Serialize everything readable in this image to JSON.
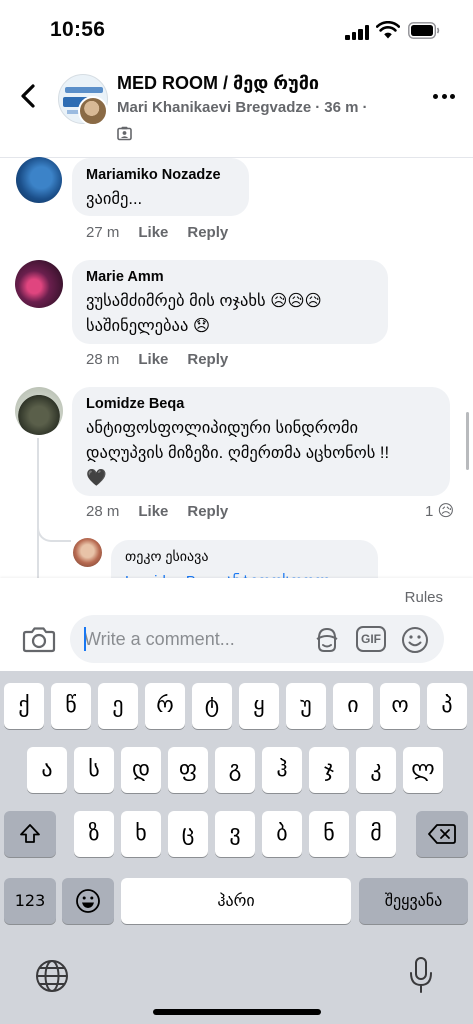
{
  "status_bar": {
    "time": "10:56"
  },
  "header": {
    "title": "MED ROOM / მედ რუმი",
    "author": "Mari Khanikaevi Bregvadze",
    "age": "36 m",
    "separator": "·"
  },
  "comments": [
    {
      "author": "Mariamiko Nozadze",
      "text": "ვაიმე...",
      "time": "27 m",
      "like_label": "Like",
      "reply_label": "Reply"
    },
    {
      "author": "Marie Amm",
      "text": "ვუსამძიმრებ მის ოჯახს 😥😥😥\nსაშინელებაა 😞",
      "time": "28 m",
      "like_label": "Like",
      "reply_label": "Reply"
    },
    {
      "author": "Lomidze Beqa",
      "text": "ანტიფოსფოლიპიდური სინდრომი\nდაღუპვის მიზეზი.  ღმერთმა აცხონოს !!\n🖤",
      "time": "28 m",
      "like_label": "Like",
      "reply_label": "Reply",
      "reaction_count": "1",
      "reaction_emoji": "😥"
    },
    {
      "author": "თეკო ესიავა",
      "text": "Lomidze Beqa ანტიფოსფოლ..."
    }
  ],
  "composer": {
    "rules_label": "Rules",
    "placeholder": "Write a comment...",
    "gif_label": "GIF"
  },
  "keyboard": {
    "row1": [
      "ქ",
      "წ",
      "ე",
      "რ",
      "ტ",
      "ყ",
      "უ",
      "ი",
      "ო",
      "პ"
    ],
    "row2": [
      "ა",
      "ს",
      "დ",
      "ფ",
      "გ",
      "ჰ",
      "ჯ",
      "კ",
      "ლ"
    ],
    "row3": [
      "ზ",
      "ხ",
      "ც",
      "ვ",
      "ბ",
      "ნ",
      "მ"
    ],
    "numbers_label": "123",
    "space_label": "ჰარი",
    "return_label": "შეყვანა"
  }
}
